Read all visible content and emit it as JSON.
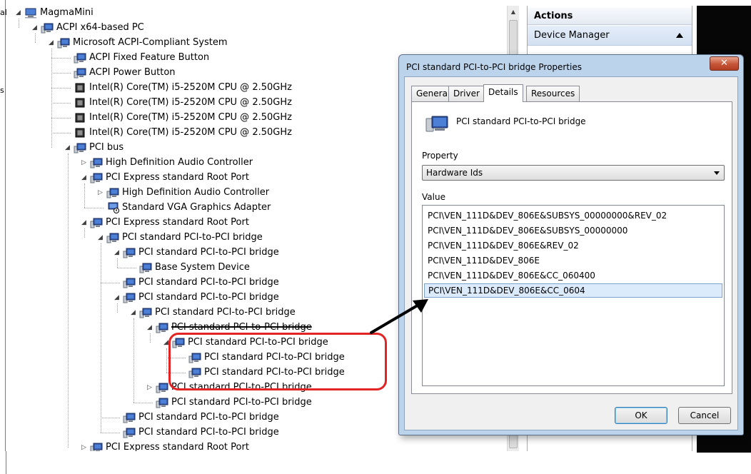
{
  "left_clip": {
    "glyph_top": "al",
    "glyph_mid": "s"
  },
  "tree": [
    {
      "label": "MagmaMini",
      "depth": 0,
      "expander": "expanded",
      "icon": "computer-icon"
    },
    {
      "label": "ACPI x64-based PC",
      "depth": 1,
      "expander": "expanded",
      "icon": "device-icon"
    },
    {
      "label": "Microsoft ACPI-Compliant System",
      "depth": 2,
      "expander": "expanded",
      "icon": "device-icon"
    },
    {
      "label": "ACPI Fixed Feature Button",
      "depth": 3,
      "expander": "none",
      "icon": "device-icon"
    },
    {
      "label": "ACPI Power Button",
      "depth": 3,
      "expander": "none",
      "icon": "device-icon"
    },
    {
      "label": "Intel(R) Core(TM) i5-2520M CPU @ 2.50GHz",
      "depth": 3,
      "expander": "none",
      "icon": "cpu-icon"
    },
    {
      "label": "Intel(R) Core(TM) i5-2520M CPU @ 2.50GHz",
      "depth": 3,
      "expander": "none",
      "icon": "cpu-icon"
    },
    {
      "label": "Intel(R) Core(TM) i5-2520M CPU @ 2.50GHz",
      "depth": 3,
      "expander": "none",
      "icon": "cpu-icon"
    },
    {
      "label": "Intel(R) Core(TM) i5-2520M CPU @ 2.50GHz",
      "depth": 3,
      "expander": "none",
      "icon": "cpu-icon"
    },
    {
      "label": "PCI bus",
      "depth": 3,
      "expander": "expanded",
      "icon": "device-icon"
    },
    {
      "label": "High Definition Audio Controller",
      "depth": 4,
      "expander": "collapsed",
      "icon": "device-icon"
    },
    {
      "label": "PCI Express standard Root Port",
      "depth": 4,
      "expander": "expanded",
      "icon": "device-icon"
    },
    {
      "label": "High Definition Audio Controller",
      "depth": 5,
      "expander": "collapsed",
      "icon": "device-icon"
    },
    {
      "label": "Standard VGA Graphics Adapter",
      "depth": 5,
      "expander": "none",
      "icon": "display-warning-icon"
    },
    {
      "label": "PCI Express standard Root Port",
      "depth": 4,
      "expander": "expanded",
      "icon": "device-icon"
    },
    {
      "label": "PCI standard PCI-to-PCI bridge",
      "depth": 5,
      "expander": "expanded",
      "icon": "device-icon"
    },
    {
      "label": "PCI standard PCI-to-PCI bridge",
      "depth": 6,
      "expander": "expanded",
      "icon": "device-icon"
    },
    {
      "label": "Base System Device",
      "depth": 7,
      "expander": "none",
      "icon": "device-icon"
    },
    {
      "label": "PCI standard PCI-to-PCI bridge",
      "depth": 6,
      "expander": "none",
      "icon": "device-icon"
    },
    {
      "label": "PCI standard PCI-to-PCI bridge",
      "depth": 6,
      "expander": "expanded",
      "icon": "device-icon"
    },
    {
      "label": "PCI standard PCI-to-PCI bridge",
      "depth": 7,
      "expander": "expanded",
      "icon": "device-icon"
    },
    {
      "label": "PCI standard PCI-to-PCI bridge",
      "depth": 8,
      "expander": "expanded",
      "icon": "device-icon",
      "struck": true
    },
    {
      "label": "PCI standard PCI-to-PCI bridge",
      "depth": 9,
      "expander": "expanded",
      "icon": "device-icon"
    },
    {
      "label": "PCI standard PCI-to-PCI bridge",
      "depth": 10,
      "expander": "none",
      "icon": "device-icon"
    },
    {
      "label": "PCI standard PCI-to-PCI bridge",
      "depth": 10,
      "expander": "none",
      "icon": "device-icon"
    },
    {
      "label": "PCI standard PCI-to-PCI bridge",
      "depth": 8,
      "expander": "collapsed",
      "icon": "device-icon"
    },
    {
      "label": "PCI standard PCI-to-PCI bridge",
      "depth": 8,
      "expander": "none",
      "icon": "device-icon"
    },
    {
      "label": "PCI standard PCI-to-PCI bridge",
      "depth": 6,
      "expander": "none",
      "icon": "device-icon"
    },
    {
      "label": "PCI standard PCI-to-PCI bridge",
      "depth": 6,
      "expander": "none",
      "icon": "device-icon"
    },
    {
      "label": "PCI Express standard Root Port",
      "depth": 4,
      "expander": "collapsed",
      "icon": "device-icon"
    }
  ],
  "actions": {
    "title": "Actions",
    "section": "Device Manager"
  },
  "dialog": {
    "title": "PCI standard PCI-to-PCI bridge Properties",
    "close_label": "✕",
    "tabs": [
      {
        "label": "General",
        "active": false
      },
      {
        "label": "Driver",
        "active": false
      },
      {
        "label": "Details",
        "active": true
      },
      {
        "label": "Resources",
        "active": false
      }
    ],
    "device_name": "PCI standard PCI-to-PCI bridge",
    "property_label": "Property",
    "property_value": "Hardware Ids",
    "value_label": "Value",
    "values": [
      {
        "text": "PCI\\VEN_111D&DEV_806E&SUBSYS_00000000&REV_02",
        "selected": false
      },
      {
        "text": "PCI\\VEN_111D&DEV_806E&SUBSYS_00000000",
        "selected": false
      },
      {
        "text": "PCI\\VEN_111D&DEV_806E&REV_02",
        "selected": false
      },
      {
        "text": "PCI\\VEN_111D&DEV_806E",
        "selected": false
      },
      {
        "text": "PCI\\VEN_111D&DEV_806E&CC_060400",
        "selected": false
      },
      {
        "text": "PCI\\VEN_111D&DEV_806E&CC_0604",
        "selected": true
      }
    ],
    "ok_label": "OK",
    "cancel_label": "Cancel"
  },
  "colors": {
    "highlight": "#e22424",
    "arrow": "#000000",
    "selection": "#dcebfc",
    "title_bar": "#bcd3ec"
  }
}
